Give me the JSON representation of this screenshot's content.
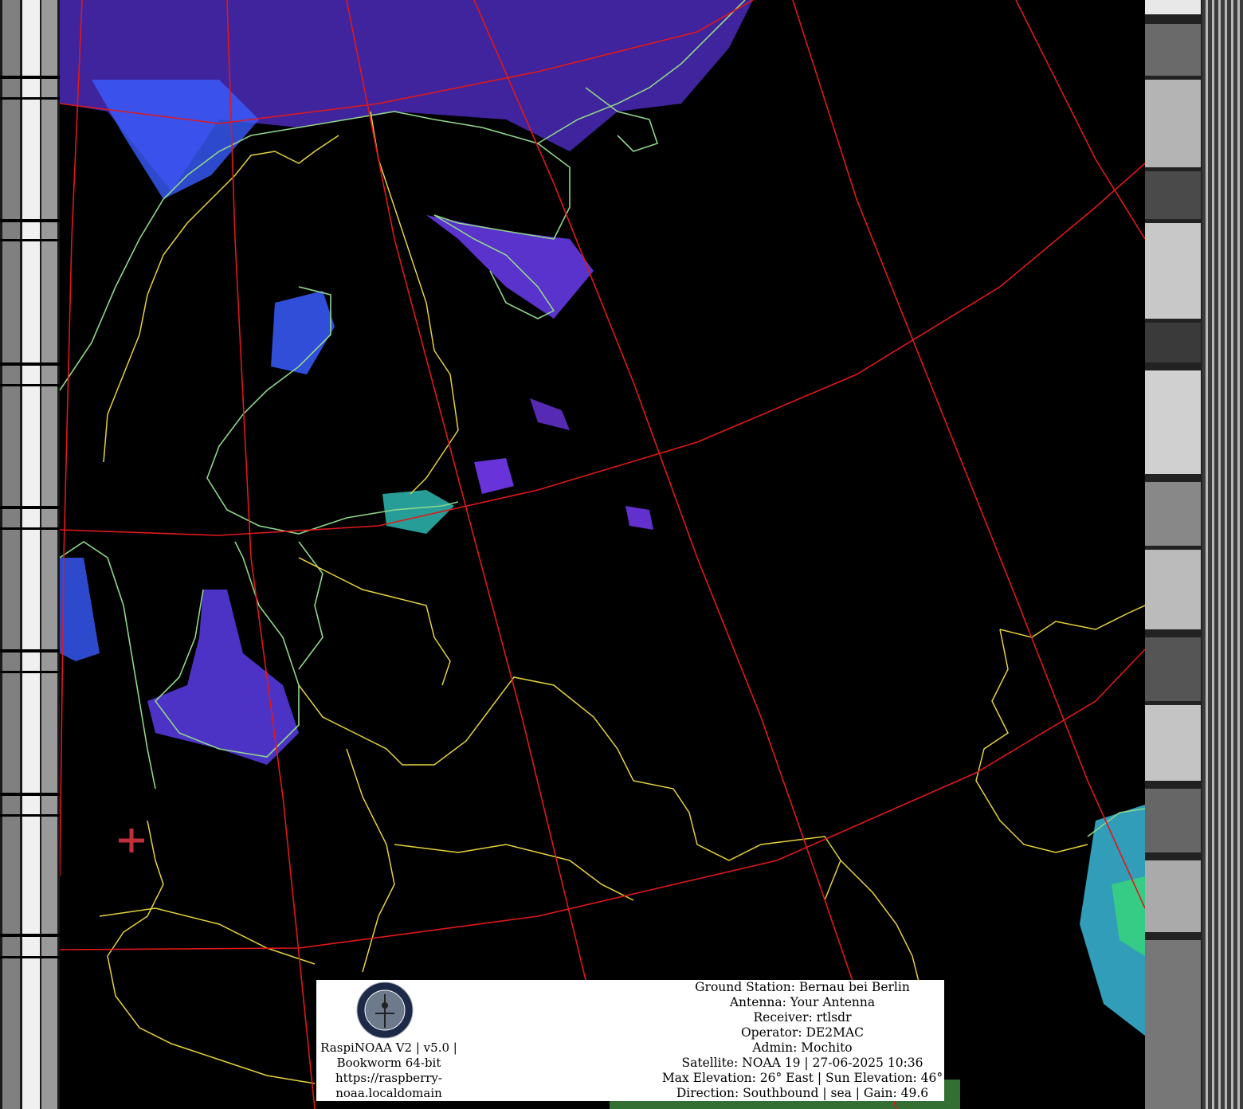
{
  "info": {
    "software": [
      "RaspiNOAA V2 | v5.0 |",
      "Bookworm 64-bit",
      "https://raspberry-",
      "noaa.localdomain"
    ],
    "station": [
      "Ground Station: Bernau bei Berlin",
      "Antenna: Your Antenna",
      "Receiver: rtlsdr",
      "Operator: DE2MAC",
      "Admin: Mochito",
      "Satellite: NOAA 19 | 27-06-2025 10:36",
      "Max Elevation: 26° East | Sun Elevation: 46°",
      "Direction: Southbound | sea | Gain: 49.6"
    ]
  },
  "colors": {
    "grid": "#e01818",
    "borders": "#e6d23c",
    "coast": "#8fd68a",
    "cloud_violet": "#7a3cff",
    "cloud_blue": "#3a5cff",
    "cloud_cyan": "#38e0d8",
    "marker": "#c0303a"
  },
  "icons": {
    "logo": "satellite-badge-icon",
    "marker": "plus-marker-icon"
  }
}
